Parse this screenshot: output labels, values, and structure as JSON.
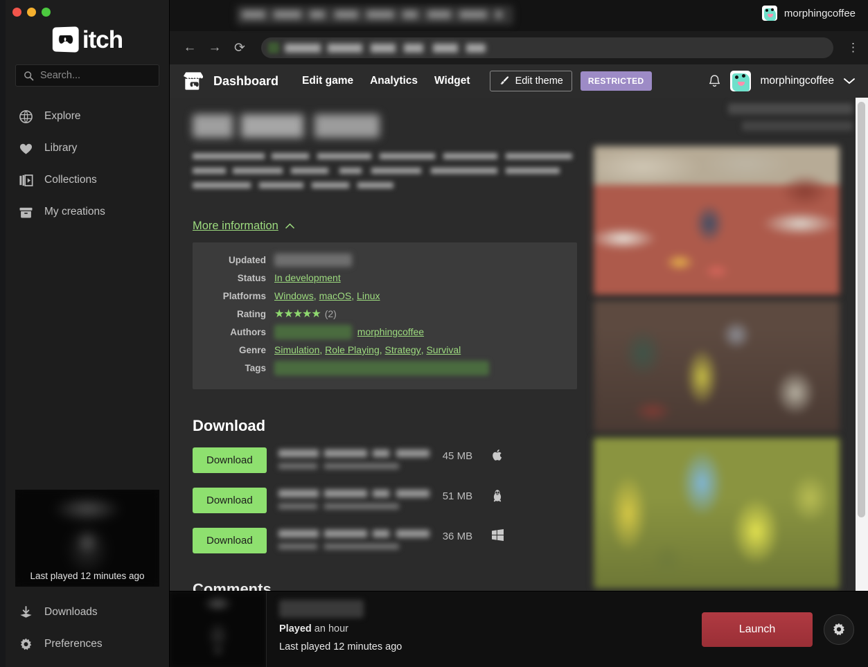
{
  "window": {
    "traffic_lights": [
      "close",
      "minimize",
      "maximize"
    ]
  },
  "brand": {
    "name": "itch",
    "logo_icon": "itch-gamepad-logo"
  },
  "sidebar": {
    "search": {
      "placeholder": "Search...",
      "value": "",
      "icon": "search-icon"
    },
    "items": [
      {
        "label": "Explore",
        "icon": "globe-icon"
      },
      {
        "label": "Library",
        "icon": "heart-icon"
      },
      {
        "label": "Collections",
        "icon": "collections-icon"
      },
      {
        "label": "My creations",
        "icon": "archive-icon"
      }
    ],
    "game_card": {
      "caption": "Last played 12 minutes ago"
    },
    "bottom_items": [
      {
        "label": "Downloads",
        "icon": "download-icon"
      },
      {
        "label": "Preferences",
        "icon": "gear-icon"
      }
    ]
  },
  "browser": {
    "back_icon": "arrow-left-icon",
    "forward_icon": "arrow-right-icon",
    "reload_icon": "reload-icon",
    "menu_icon": "kebab-menu-icon",
    "tab_title": "",
    "url": "",
    "account_name": "morphingcoffee",
    "account_avatar": "morphingcoffee-avatar"
  },
  "itch_nav": {
    "dashboard_label": "Dashboard",
    "dashboard_icon": "itch-store-icon",
    "links": [
      {
        "label": "Edit game"
      },
      {
        "label": "Analytics"
      },
      {
        "label": "Widget"
      }
    ],
    "edit_theme": {
      "label": "Edit theme",
      "icon": "paintbrush-icon"
    },
    "restricted_badge": {
      "label": "RESTRICTED",
      "color": "#9d8bc6"
    },
    "bell_icon": "bell-icon",
    "user_name": "morphingcoffee",
    "chevron_icon": "chevron-down-icon"
  },
  "page": {
    "title": "",
    "description": "",
    "more_information": {
      "label": "More information",
      "chevron": "chevron-up-icon"
    },
    "info_rows": [
      {
        "key": "Updated",
        "redacted": true,
        "value": ""
      },
      {
        "key": "Status",
        "links": [
          "In development"
        ]
      },
      {
        "key": "Platforms",
        "links": [
          "Windows",
          "macOS",
          "Linux"
        ]
      },
      {
        "key": "Rating",
        "stars": 5,
        "count": "(2)"
      },
      {
        "key": "Authors",
        "redacted": true,
        "links": [
          "morphingcoffee"
        ]
      },
      {
        "key": "Genre",
        "links": [
          "Simulation",
          "Role Playing",
          "Strategy",
          "Survival"
        ]
      },
      {
        "key": "Tags",
        "redacted": true,
        "value": ""
      }
    ],
    "download": {
      "heading": "Download",
      "rows": [
        {
          "button_label": "Download",
          "size": "45 MB",
          "os": "apple-icon",
          "name": "",
          "meta": ""
        },
        {
          "button_label": "Download",
          "size": "51 MB",
          "os": "linux-icon",
          "name": "",
          "meta": ""
        },
        {
          "button_label": "Download",
          "size": "36 MB",
          "os": "windows-icon",
          "name": "",
          "meta": ""
        }
      ]
    },
    "comments_heading": "Comments",
    "gallery": {
      "screenshot_count": 3,
      "thumbnail_count": 5
    }
  },
  "bottom_bar": {
    "game_title": "",
    "played_label": "Played",
    "played_value": "an hour",
    "last_played": "Last played 12 minutes ago",
    "launch_label": "Launch",
    "gear_icon": "gear-icon"
  },
  "colors": {
    "accent_green": "#9ddb7f",
    "download_green": "#8ee06f",
    "restricted_purple": "#9d8bc6",
    "launch_red": "#b03a42",
    "page_bg": "#2b2b2b",
    "sidebar_bg": "#1d1d1d"
  }
}
